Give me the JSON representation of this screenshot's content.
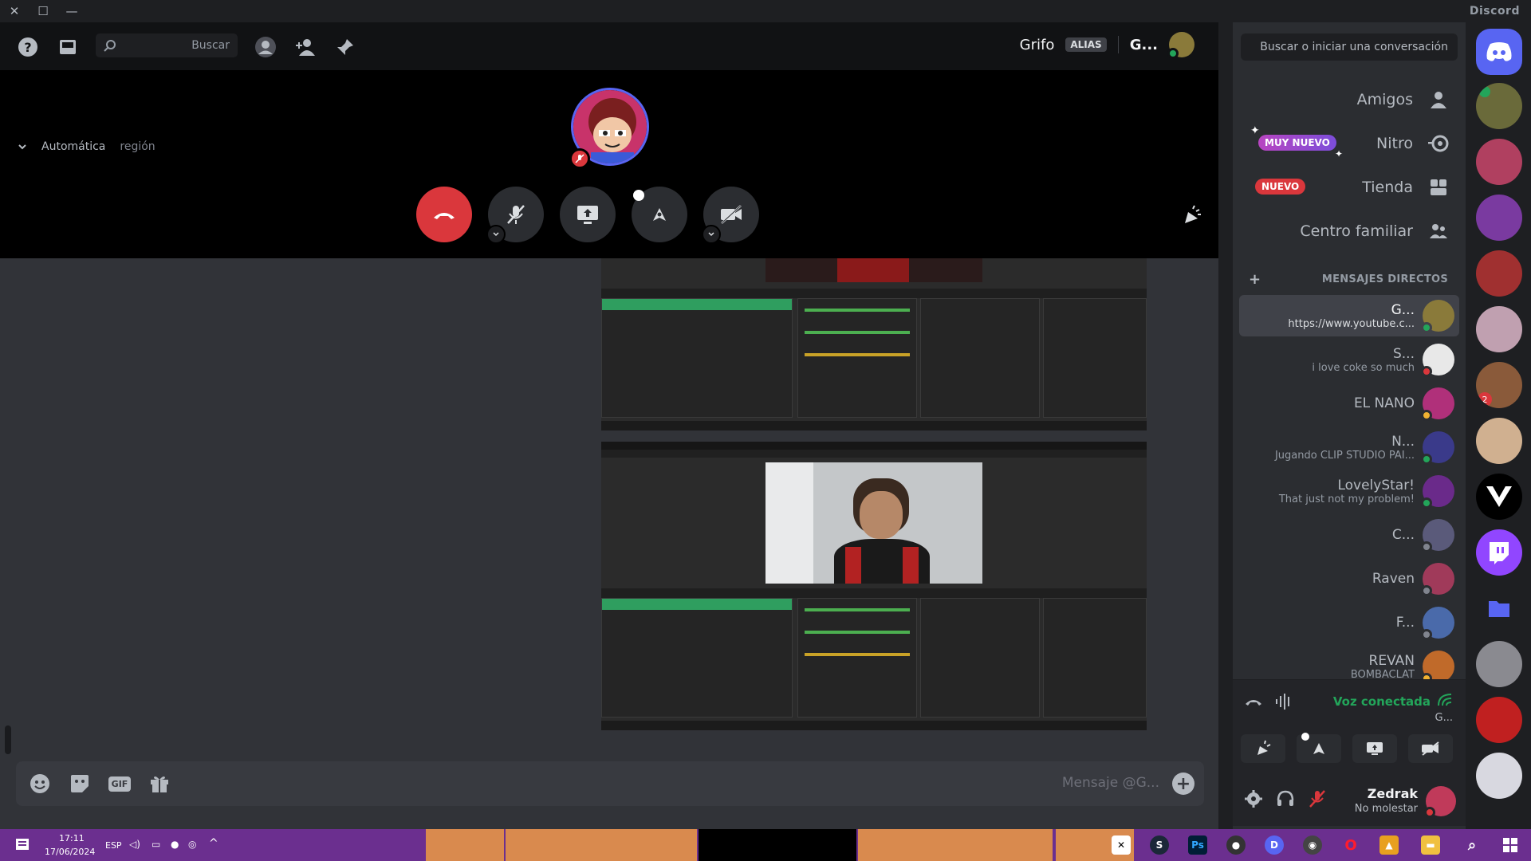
{
  "window": {
    "app_name": "Discord",
    "close": "✕",
    "maximize": "☐",
    "minimize": "—"
  },
  "header": {
    "search_placeholder": "Buscar",
    "user_name": "G...",
    "alias_badge": "ALIAS",
    "alias_name": "Grifo",
    "region_label": "región",
    "region_value": "Automática"
  },
  "sidebar": {
    "search_placeholder": "Buscar o iniciar una conversación",
    "nav": [
      {
        "label": "Amigos",
        "icon": "friends-icon"
      },
      {
        "label": "Nitro",
        "icon": "nitro-icon",
        "badge": "MUY NUEVO"
      },
      {
        "label": "Tienda",
        "icon": "shop-icon",
        "badge": "NUEVO"
      },
      {
        "label": "Centro familiar",
        "icon": "family-icon"
      }
    ],
    "dm_header": "MENSAJES DIRECTOS",
    "dm_add": "+",
    "dms": [
      {
        "name": "G...",
        "sub": "https://www.youtube.c...",
        "active": true,
        "avatar_color": "#8a7a3a",
        "status_color": "#23a55a"
      },
      {
        "name": "S...",
        "sub": "i love coke so much",
        "avatar_color": "#e8e8e8",
        "status_color": "#da373c"
      },
      {
        "name": "EL NANO",
        "sub": "",
        "avatar_color": "#b0307a",
        "status_color": "#f0b232"
      },
      {
        "name": "N...",
        "sub": "Jugando CLIP STUDIO PAI...",
        "avatar_color": "#3a3a8a",
        "status_color": "#23a55a"
      },
      {
        "name": "LovelyStar!",
        "sub": "That just not my problem!",
        "avatar_color": "#6a2a8a",
        "status_color": "#23a55a"
      },
      {
        "name": "C...",
        "sub": "",
        "avatar_color": "#5a5a7a",
        "status_color": "#80848e"
      },
      {
        "name": "Raven",
        "sub": "",
        "avatar_color": "#a03a5a",
        "status_color": "#80848e"
      },
      {
        "name": "F...",
        "sub": "",
        "avatar_color": "#4a6aaa",
        "status_color": "#80848e"
      },
      {
        "name": "REVAN",
        "sub": "BOMBACLAT",
        "avatar_color": "#c06a2a",
        "status_color": "#f0b232"
      }
    ]
  },
  "voice": {
    "title": "Voz conectada",
    "channel": "G..."
  },
  "user": {
    "name": "Zedrak",
    "status": "No molestar"
  },
  "composer": {
    "placeholder": "Mensaje @G...",
    "gif_label": "GIF"
  },
  "taskbar": {
    "time": "17:11",
    "date": "17/06/2024",
    "lang": "ESP"
  },
  "colors": {
    "accent": "#5865f2",
    "danger": "#da373c",
    "online": "#23a55a",
    "taskbar": "#6b2f8f"
  }
}
